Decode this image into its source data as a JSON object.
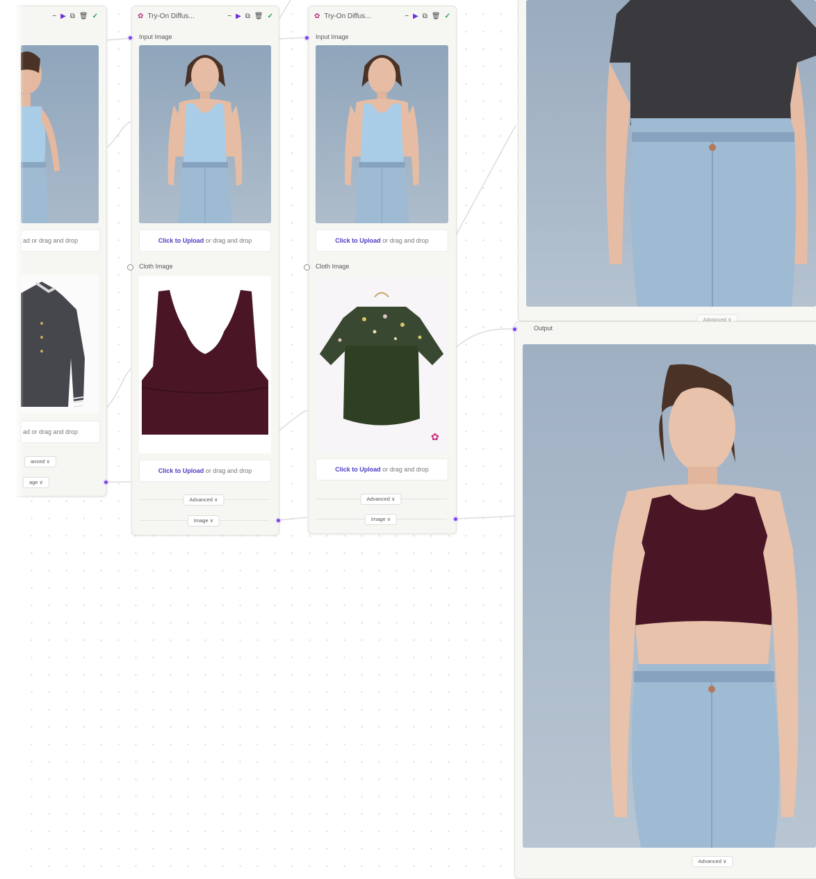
{
  "nodes": {
    "left_partial": {
      "header_icons": [
        "minus-icon",
        "play-icon",
        "copy-icon",
        "trash-icon",
        "check-icon"
      ],
      "upload_tail_top": "ad or drag and drop",
      "upload_tail_bottom": "ad or drag and drop",
      "advanced_label": "anced ∨",
      "image_label": "age ∨"
    },
    "middle": {
      "title": "Try-On Diffus...",
      "input_label": "Input Image",
      "cloth_label": "Cloth Image",
      "upload_link": "Click to Upload",
      "upload_rest": " or drag and drop",
      "advanced_label": "Advanced ∨",
      "image_label": "Image ∨"
    },
    "right": {
      "title": "Try-On Diffus...",
      "input_label": "Input Image",
      "cloth_label": "Cloth Image",
      "upload_link": "Click to Upload",
      "upload_rest": " or drag and drop",
      "advanced_label": "Advanced ∨",
      "image_label": "Image ∨"
    },
    "output": {
      "label": "Output",
      "advanced_label": "Advanced ∨"
    }
  },
  "colors": {
    "accent": "#7b3fe4",
    "link": "#4a3bc4",
    "check": "#22a04b",
    "tank_top": "#a9cde6",
    "sports_bra": "#4a1626",
    "blouse": "#2f3f24",
    "tshirt": "#3a3a3e",
    "jeans": "#9fbad3"
  }
}
